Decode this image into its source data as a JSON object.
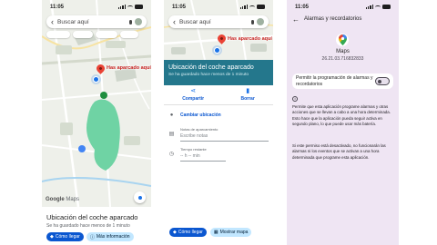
{
  "panel1": {
    "status_time": "11:05",
    "search_placeholder": "Buscar aquí",
    "pin_label": "Has aparcado aquí",
    "google_logo": "Google",
    "maps_word": "Maps",
    "sheet_title": "Ubicación del coche aparcado",
    "sheet_subtitle": "Se ha guardado hace menos de 1 minuto",
    "directions_label": "Cómo llegar",
    "more_info_label": "Más información"
  },
  "panel2": {
    "status_time": "11:05",
    "search_placeholder": "Buscar aquí",
    "pin_label": "Has aparcado aquí",
    "card_title": "Ubicación del coche aparcado",
    "card_subtitle": "Se ha guardado hace menos de 1 minuto",
    "share_label": "Compartir",
    "delete_label": "Borrar",
    "change_location": "Cambiar ubicación",
    "notes_label": "Notas de aparcamiento",
    "notes_placeholder": "Escribe notas",
    "time_label": "Tiempo restante",
    "time_placeholder": "-- h -- min",
    "directions_label": "Cómo llegar",
    "show_map_label": "Mostrar mapa"
  },
  "panel3": {
    "status_time": "11:05",
    "title": "Alarmas y recordatorios",
    "app_name": "Maps",
    "app_version": "26.21.03.716832833",
    "permission_label": "Permitir la programación de alarmas y recordatorios",
    "permission_enabled": false,
    "info_p1": "Permite que esta aplicación programe alarmas y otras acciones que se llevan a cabo a una hora determinada. Esto hace que la aplicación pueda seguir activa en segundo plano, lo que puede usar más batería.",
    "info_p2": "Si este permiso está desactivado, no funcionarán las alarmas ni los eventos que se activan a una hora determinada que programe esta aplicación."
  },
  "icons": {
    "back": "arrow-left-icon",
    "mic": "mic-icon",
    "pin": "map-pin-icon",
    "location": "my-location-icon",
    "share": "share-icon",
    "delete": "delete-icon",
    "notes": "notes-icon",
    "timer": "timer-icon",
    "info": "info-icon",
    "maps_logo": "google-maps-icon"
  },
  "colors": {
    "accent": "#0b57d0",
    "card_teal": "#24778c",
    "pin_red": "#ea4335",
    "park_green": "#6fd3a4",
    "settings_bg": "#efe5f3"
  }
}
